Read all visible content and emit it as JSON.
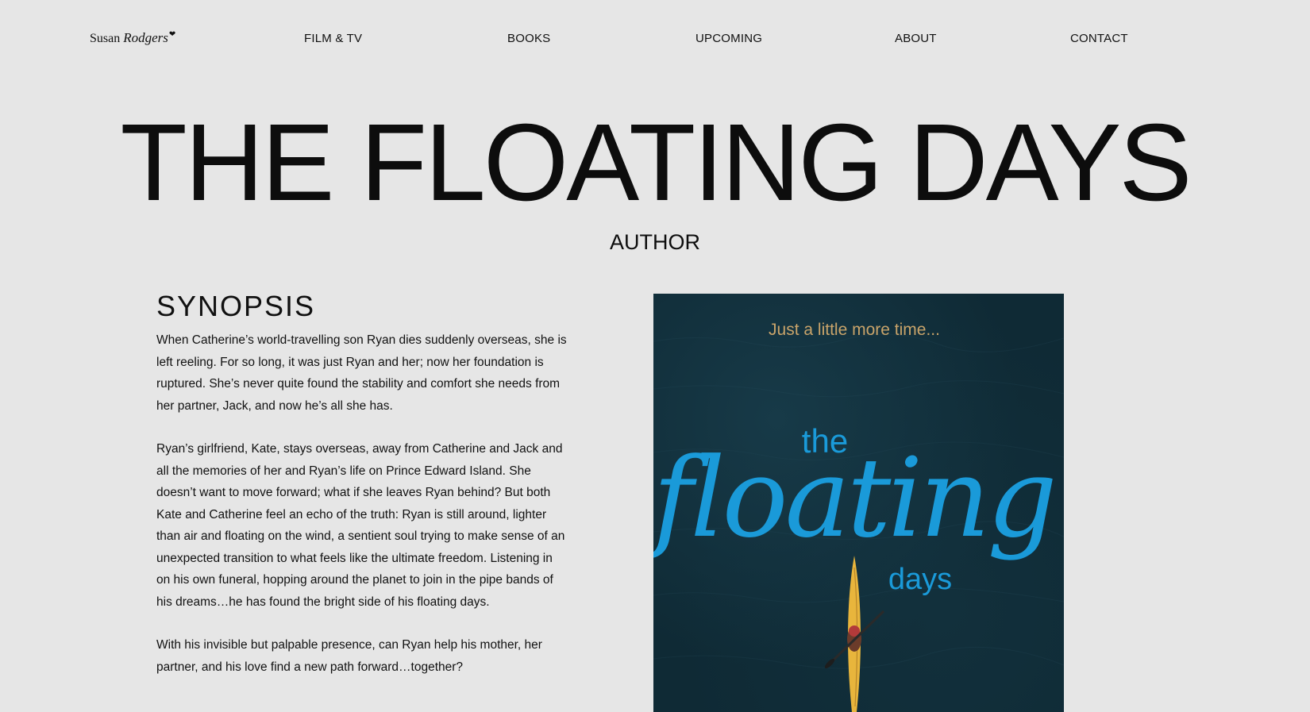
{
  "header": {
    "logo": {
      "first": "Susan",
      "last": "Rodgers",
      "mark": "❤"
    },
    "nav": [
      {
        "label": "FILM & TV"
      },
      {
        "label": "BOOKS"
      },
      {
        "label": "UPCOMING"
      },
      {
        "label": "ABOUT"
      },
      {
        "label": "CONTACT"
      }
    ]
  },
  "book": {
    "title": "THE FLOATING DAYS",
    "role": "AUTHOR"
  },
  "synopsis": {
    "heading": "SYNOPSIS",
    "paragraphs": [
      "When Catherine’s world-travelling son Ryan dies suddenly overseas, she is left reeling. For so long, it was just Ryan and her; now her foundation is ruptured. She’s never quite found the stability and comfort she needs from her partner, Jack, and now he’s all she has.",
      "Ryan’s girlfriend, Kate, stays overseas, away from Catherine and Jack and all the memories of her and Ryan’s life on Prince Edward Island. She doesn’t want to move forward; what if she leaves Ryan behind? But both Kate and Catherine feel an echo of the truth: Ryan is still around, lighter than air and floating on the wind, a sentient soul trying to make sense of an unexpected transition to what feels like the ultimate freedom. Listening in on his own funeral, hopping around the planet to join in the pipe bands of his dreams…he has found the bright side of his floating days.",
      "With his invisible but palpable presence, can Ryan help his mother, her partner, and his love find a new path forward…together?"
    ]
  },
  "cover": {
    "tagline": "Just a little more time...",
    "title_small": "the",
    "title_script": "floating",
    "title_end": "days",
    "colors": {
      "background": "#0f2a35",
      "script": "#1a9ad9",
      "tagline": "#c9a46a",
      "kayak": "#e8b53c"
    }
  }
}
